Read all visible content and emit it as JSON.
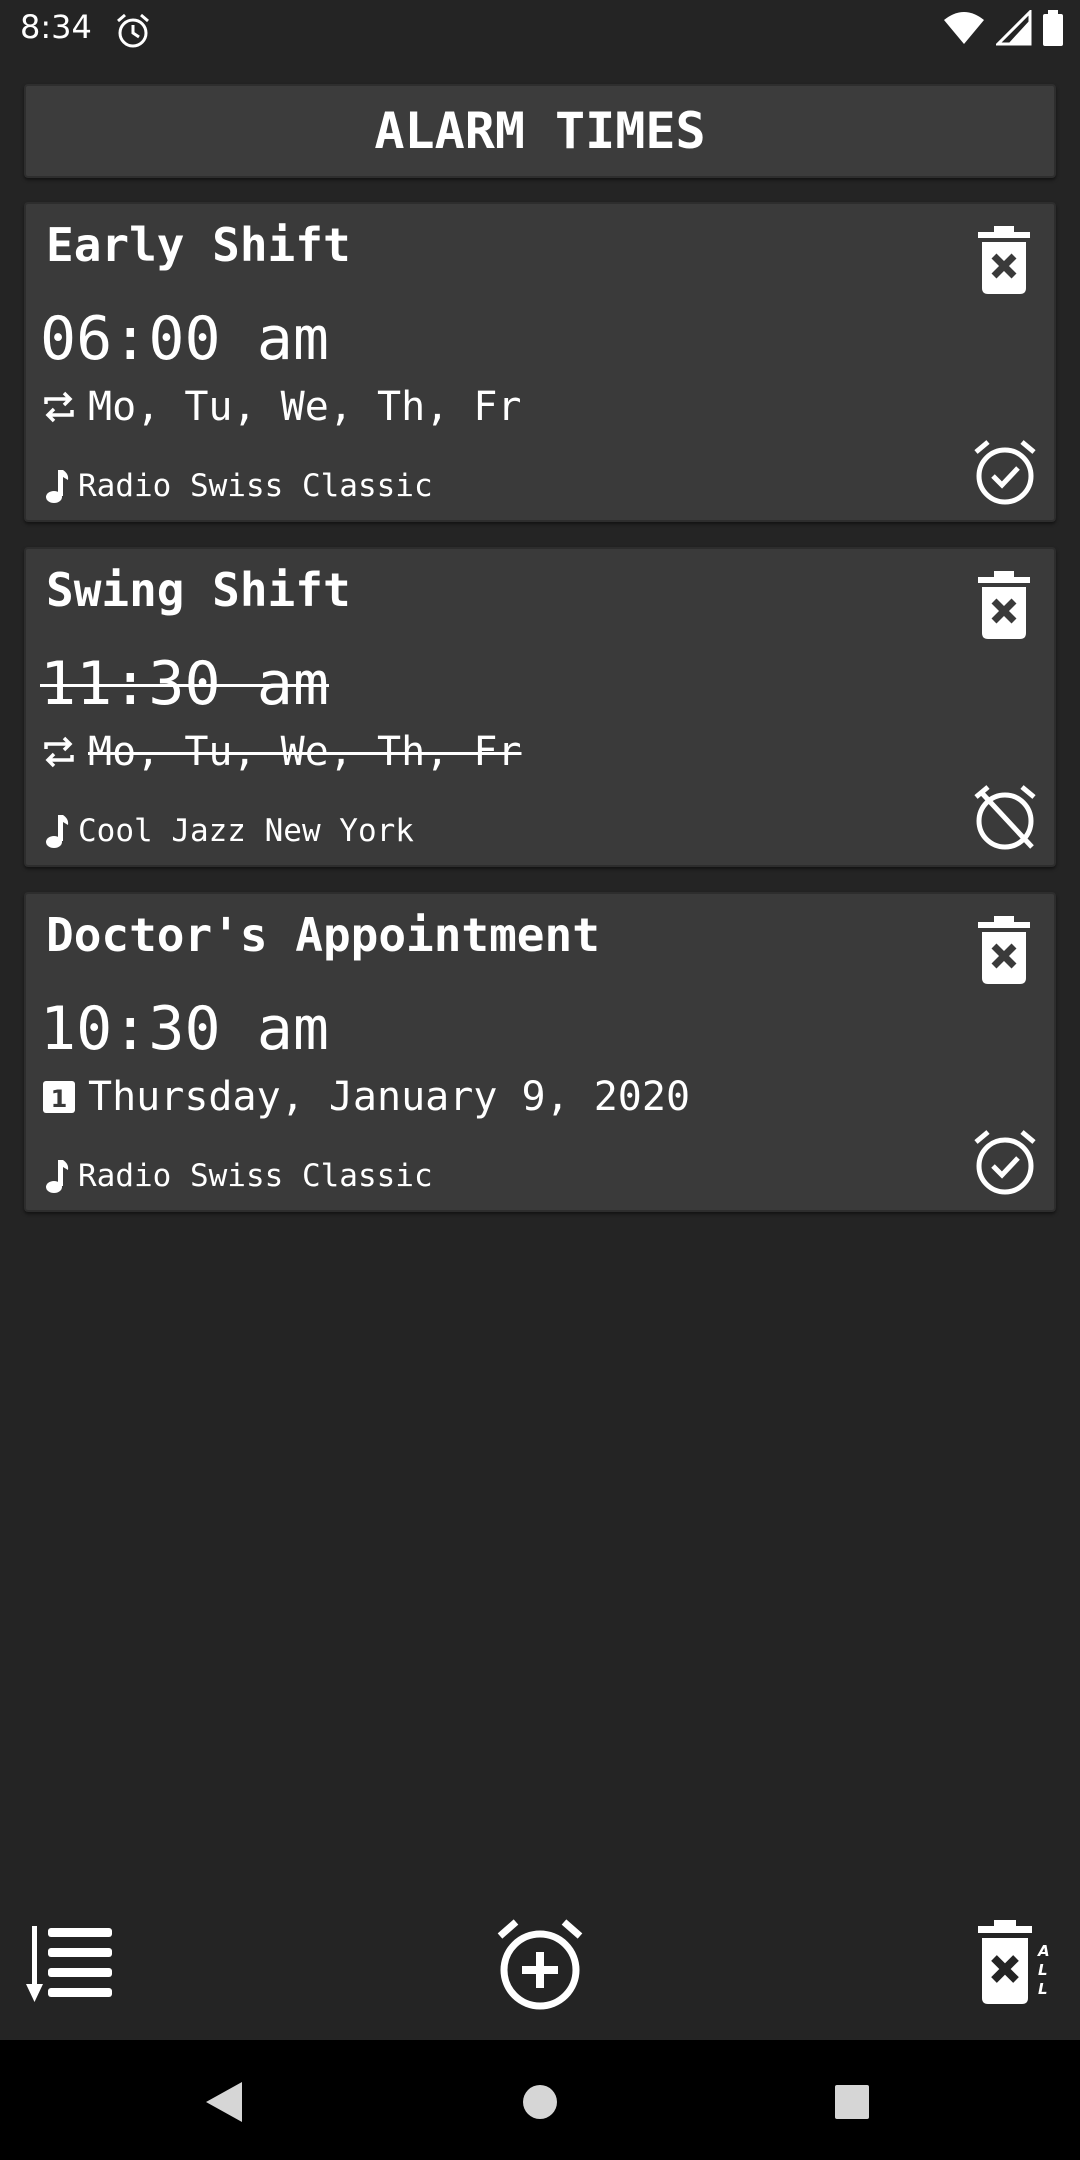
{
  "status_bar": {
    "time": "8:34"
  },
  "header": {
    "title": "ALARM TIMES"
  },
  "alarms": [
    {
      "title": "Early Shift",
      "time": "06:00 am",
      "schedule": "Mo, Tu, We, Th, Fr",
      "station": "Radio Swiss Classic",
      "enabled": true,
      "repeat": true
    },
    {
      "title": "Swing Shift",
      "time": "11:30 am",
      "schedule": "Mo, Tu, We, Th, Fr",
      "station": "Cool Jazz New York",
      "enabled": false,
      "repeat": true
    },
    {
      "title": "Doctor's Appointment",
      "time": "10:30 am",
      "schedule": "Thursday, January 9, 2020",
      "station": "Radio Swiss Classic",
      "enabled": true,
      "repeat": false,
      "date_icon_number": "1"
    }
  ],
  "toolbar": {
    "delete_all_badge": "ALL"
  },
  "icons": {
    "status_alarm": "alarm-clock-icon",
    "wifi": "wifi-icon",
    "signal": "signal-icon",
    "battery": "battery-icon",
    "repeat": "repeat-icon",
    "calendar": "calendar-day-icon",
    "music": "music-note-icon",
    "trash": "trash-icon",
    "alarm_on": "alarm-check-icon",
    "alarm_off": "alarm-off-icon",
    "sort": "sort-list-icon",
    "add_alarm": "alarm-add-icon",
    "delete_all": "delete-all-icon"
  },
  "colors": {
    "background": "#242424",
    "card": "#3a3a3a",
    "text": "#ffffff",
    "nav_bar": "#000000"
  }
}
